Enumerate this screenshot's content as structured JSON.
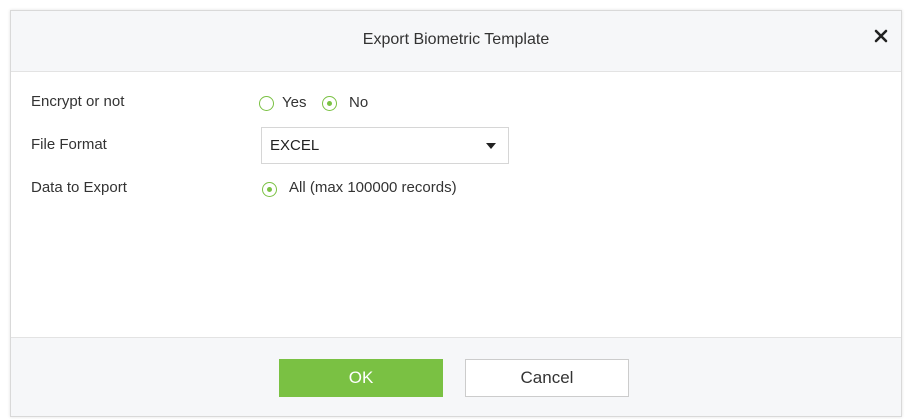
{
  "dialog": {
    "title": "Export Biometric Template",
    "close_icon": "close-icon",
    "accent_color": "#7ac143"
  },
  "form": {
    "encrypt": {
      "label": "Encrypt or not",
      "options": [
        "Yes",
        "No"
      ],
      "selected": "No"
    },
    "file_format": {
      "label": "File Format",
      "value": "EXCEL"
    },
    "data_to_export": {
      "label": "Data to Export",
      "options": [
        "All (max 100000 records)"
      ],
      "selected": "All (max 100000 records)"
    }
  },
  "footer": {
    "ok_label": "OK",
    "cancel_label": "Cancel"
  }
}
